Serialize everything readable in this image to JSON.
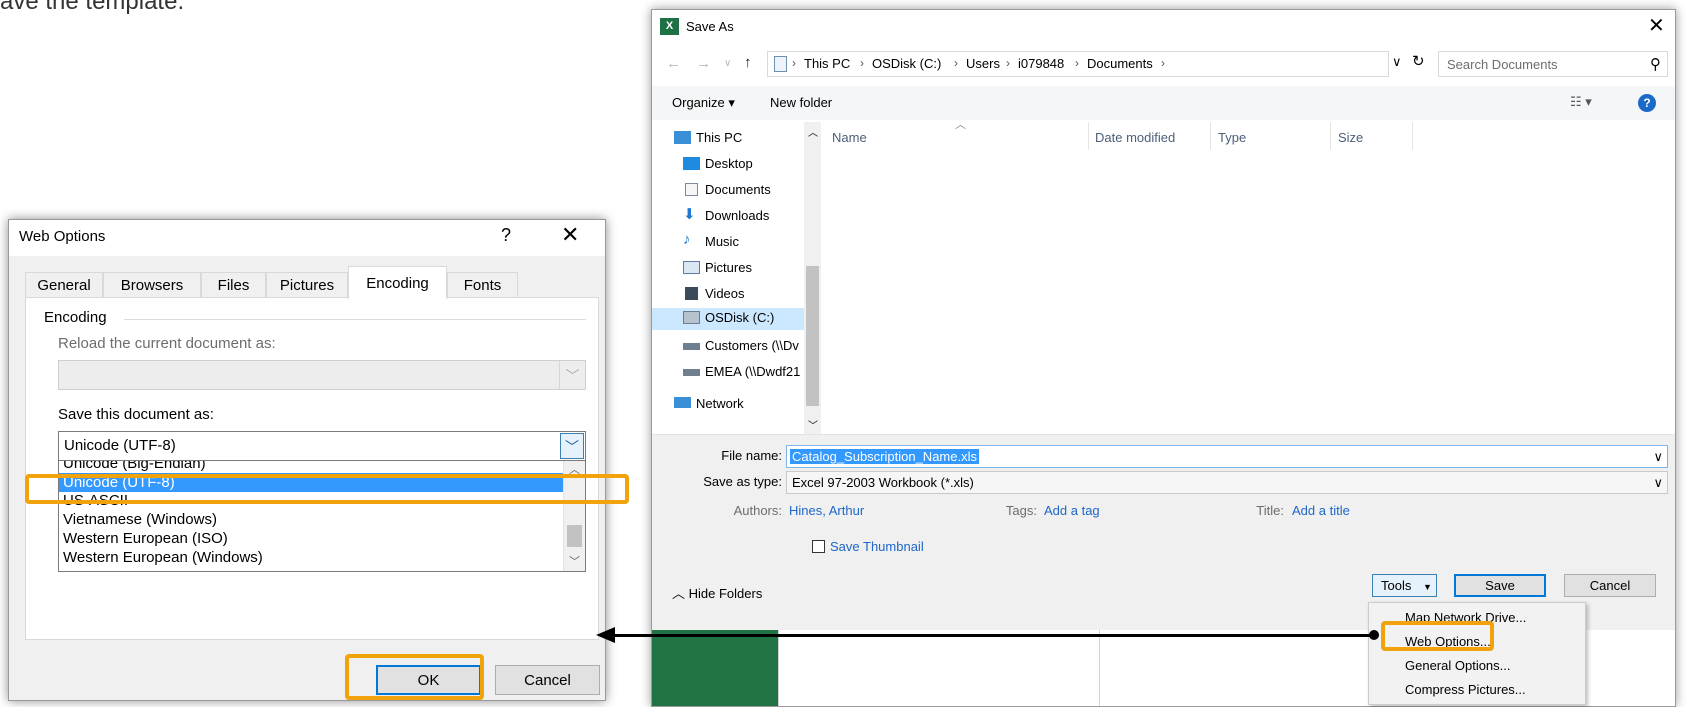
{
  "caption_fragment": "ave the template.",
  "web_options": {
    "title": "Web Options",
    "help": "?",
    "close": "✕",
    "tabs": [
      "General",
      "Browsers",
      "Files",
      "Pictures",
      "Encoding",
      "Fonts"
    ],
    "active_tab": "Encoding",
    "group_label": "Encoding",
    "reload_label": "Reload the current document as:",
    "save_label": "Save this document as:",
    "save_value": "Unicode (UTF-8)",
    "list_items": [
      "Unicode (Big-Endian)",
      "Unicode (UTF-8)",
      "US-ASCII",
      "Vietnamese (Windows)",
      "Western European (ISO)",
      "Western European (Windows)"
    ],
    "selected_item": "Unicode (UTF-8)",
    "ok": "OK",
    "cancel": "Cancel"
  },
  "save_as": {
    "title": "Save As",
    "close": "✕",
    "breadcrumbs": [
      "This PC",
      "OSDisk (C:)",
      "Users",
      "i079848",
      "Documents"
    ],
    "search_placeholder": "Search Documents",
    "organize": "Organize ▾",
    "new_folder": "New folder",
    "nav_items": [
      {
        "label": "This PC",
        "icon": "pc-icon"
      },
      {
        "label": "Desktop",
        "icon": "desktop-icon"
      },
      {
        "label": "Documents",
        "icon": "documents-icon"
      },
      {
        "label": "Downloads",
        "icon": "downloads-icon"
      },
      {
        "label": "Music",
        "icon": "music-icon"
      },
      {
        "label": "Pictures",
        "icon": "pictures-icon"
      },
      {
        "label": "Videos",
        "icon": "videos-icon"
      },
      {
        "label": "OSDisk (C:)",
        "icon": "drive-icon"
      },
      {
        "label": "Customers (\\\\Dv",
        "icon": "network-drive-icon"
      },
      {
        "label": "EMEA (\\\\Dwdf21",
        "icon": "network-drive-icon"
      },
      {
        "label": "Network",
        "icon": "network-icon"
      }
    ],
    "selected_nav": "OSDisk (C:)",
    "columns": [
      "Name",
      "Date modified",
      "Type",
      "Size"
    ],
    "file_name_label": "File name:",
    "file_name": "Catalog_Subscription_Name.xls",
    "save_type_label": "Save as type:",
    "save_type": "Excel 97-2003 Workbook (*.xls)",
    "authors_label": "Authors:",
    "authors": "Hines, Arthur",
    "tags_label": "Tags:",
    "tags": "Add a tag",
    "title_label": "Title:",
    "title_value": "Add a title",
    "save_thumbnail": "Save Thumbnail",
    "hide_folders": "Hide Folders",
    "tools": "Tools",
    "save": "Save",
    "cancel": "Cancel"
  },
  "tools_menu": [
    "Map Network Drive...",
    "Web Options...",
    "General Options...",
    "Compress Pictures..."
  ],
  "colors": {
    "highlight": "#f2a20a",
    "selection": "#3399ff",
    "excel_green": "#217346",
    "link": "#1e66c8"
  }
}
